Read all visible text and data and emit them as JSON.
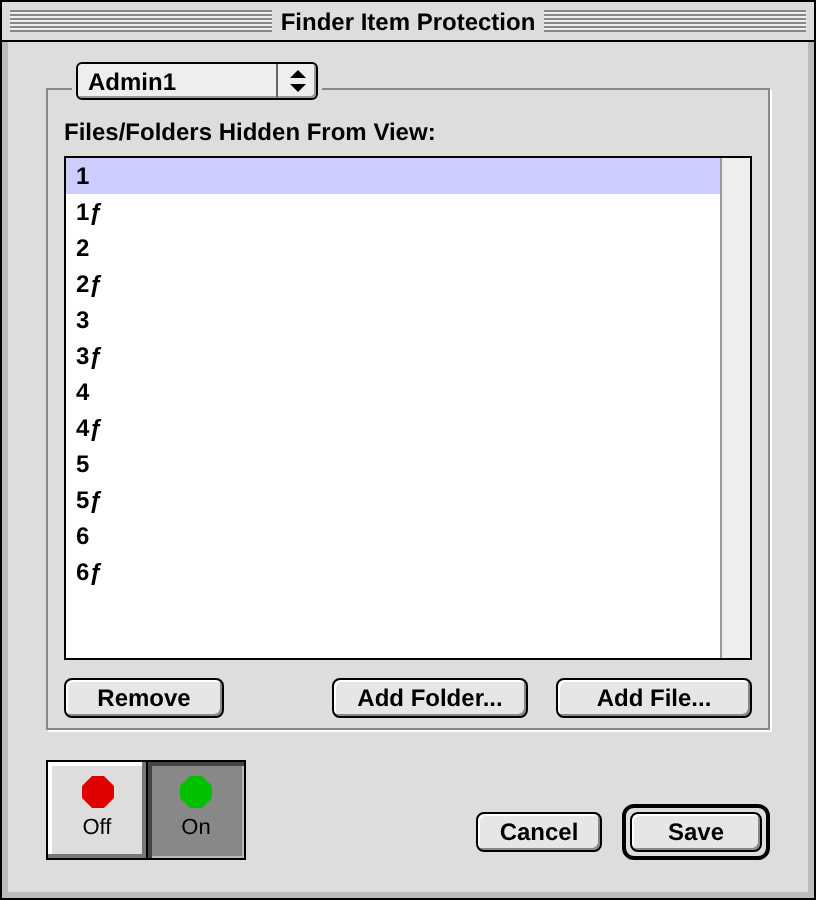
{
  "window": {
    "title": "Finder Item Protection"
  },
  "user_popup": {
    "value": "Admin1"
  },
  "list": {
    "label": "Files/Folders Hidden From View:",
    "items": [
      {
        "text": "1",
        "selected": true
      },
      {
        "text": "1ƒ",
        "selected": false
      },
      {
        "text": "2",
        "selected": false
      },
      {
        "text": "2ƒ",
        "selected": false
      },
      {
        "text": "3",
        "selected": false
      },
      {
        "text": "3ƒ",
        "selected": false
      },
      {
        "text": "4",
        "selected": false
      },
      {
        "text": "4ƒ",
        "selected": false
      },
      {
        "text": "5",
        "selected": false
      },
      {
        "text": "5ƒ",
        "selected": false
      },
      {
        "text": "6",
        "selected": false
      },
      {
        "text": "6ƒ",
        "selected": false
      }
    ]
  },
  "list_buttons": [
    "Remove",
    "Add Folder...",
    "Add File..."
  ],
  "toggles": [
    {
      "label": "Off",
      "color": "#e00000",
      "selected": false
    },
    {
      "label": "On",
      "color": "#00c000",
      "selected": true
    }
  ],
  "buttons": [
    {
      "label": "Cancel",
      "default": false
    },
    {
      "label": "Save",
      "default": true
    }
  ]
}
